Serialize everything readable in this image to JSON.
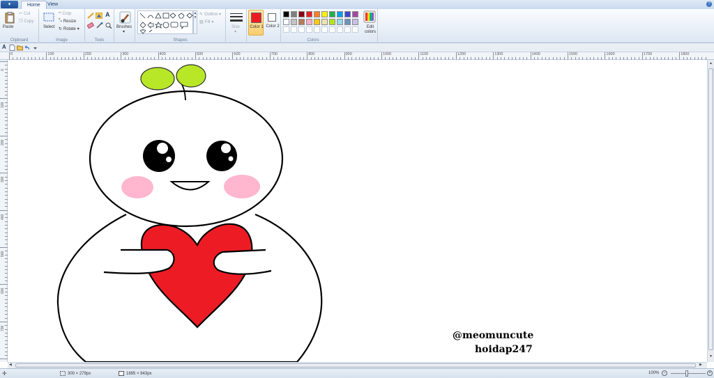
{
  "app_menu": {
    "label": "▾"
  },
  "tabs": [
    {
      "label": "Home",
      "active": true
    },
    {
      "label": "View",
      "active": false
    }
  ],
  "help": {
    "label": "?"
  },
  "ribbon": {
    "clipboard": {
      "title": "Clipboard",
      "paste": "Paste",
      "cut": "Cut",
      "copy": "Copy"
    },
    "image": {
      "title": "Image",
      "select": "Select",
      "crop": "Crop",
      "resize": "Resize",
      "rotate": "Rotate"
    },
    "tools": {
      "title": "Tools",
      "text_tool": "A"
    },
    "brushes": {
      "label": "Brushes"
    },
    "shapes": {
      "title": "Shapes",
      "outline": "Outline",
      "fill": "Fill"
    },
    "size": {
      "label": "Size"
    },
    "color1": {
      "label": "Color 1",
      "hex": "#ed1c24"
    },
    "color2": {
      "label": "Color 2",
      "hex": "#ffffff"
    },
    "colors": {
      "title": "Colors",
      "row1": [
        "#000000",
        "#7f7f7f",
        "#880015",
        "#ed1c24",
        "#ff7f27",
        "#fff200",
        "#22b14c",
        "#00a2e8",
        "#3f48cc",
        "#a349a4"
      ],
      "row2": [
        "#ffffff",
        "#c3c3c3",
        "#b97a57",
        "#ffaec9",
        "#ffc90e",
        "#efe4b0",
        "#b5e61d",
        "#99d9ea",
        "#7092be",
        "#c8bfe7"
      ],
      "edit_colors": "Edit colors"
    }
  },
  "ruler": {
    "horizontal": [
      "0",
      "100",
      "200",
      "300",
      "400",
      "500",
      "600",
      "700",
      "800",
      "900",
      "1000",
      "1100",
      "1200",
      "1300",
      "1400",
      "1500",
      "1600",
      "1700",
      "1800"
    ],
    "vertical": [
      "0",
      "100",
      "200",
      "300",
      "400",
      "500",
      "600",
      "700"
    ]
  },
  "drawing": {
    "watermark1": "@meomuncute",
    "watermark2": "hoidap247",
    "heart_color": "#ed1c24",
    "leaf_color": "#b5e61d",
    "blush_color": "#ffaec9"
  },
  "status": {
    "selection_size": "300 × 279px",
    "image_size": "1895 × 943px",
    "zoom": "100%"
  }
}
